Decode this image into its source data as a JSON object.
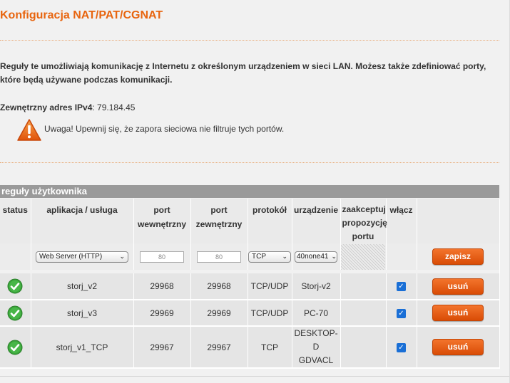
{
  "page": {
    "title": "Konfiguracja NAT/PAT/CGNAT",
    "intro": "Reguły te umożliwiają komunikację z Internetu z określonym urządzeniem w sieci LAN. Możesz także zdefiniować porty, które będą używane podczas komunikacji.",
    "ext_label": "Zewnętrzny adres IPv4",
    "ext_value": ": 79.184.45",
    "warning": "Uwaga! Upewnij się, że zapora sieciowa nie filtruje tych portów.",
    "warning_icon": "warning-triangle-icon"
  },
  "section": {
    "title": "reguły użytkownika"
  },
  "table": {
    "headers": {
      "status": "status",
      "app": "aplikacja / usługa",
      "port_int_1": "port",
      "port_int_2": "wewnętrzny",
      "port_ext_1": "port",
      "port_ext_2": "zewnętrzny",
      "protocol": "protokół",
      "device": "urządzenie",
      "accept_1": "zaakceptuj",
      "accept_2": "propozycję",
      "accept_3": "portu",
      "enable": "włącz"
    },
    "new_rule": {
      "app_select": "Web Server (HTTP)",
      "port_int_placeholder": "80",
      "port_ext_placeholder": "80",
      "protocol_select": "TCP",
      "device_select": "40none41",
      "save_label": "zapisz"
    },
    "rows": [
      {
        "status_icon": "check-ok-icon",
        "app": "storj_v2",
        "port_int": "29968",
        "port_ext": "29968",
        "protocol": "TCP/UDP",
        "device": "Storj-v2",
        "device_2": "",
        "enabled": true,
        "delete_label": "usuń"
      },
      {
        "status_icon": "check-ok-icon",
        "app": "storj_v3",
        "port_int": "29969",
        "port_ext": "29969",
        "protocol": "TCP/UDP",
        "device": "PC-70",
        "device_2": "",
        "enabled": true,
        "delete_label": "usuń"
      },
      {
        "status_icon": "check-ok-icon",
        "app": "storj_v1_TCP",
        "port_int": "29967",
        "port_ext": "29967",
        "protocol": "TCP",
        "device": "DESKTOP-D",
        "device_2": "GDVACL",
        "enabled": true,
        "delete_label": "usuń"
      }
    ]
  },
  "colors": {
    "accent": "#e8650f",
    "button": "#e05a10",
    "header_bar": "#9a9a9a",
    "check_green": "#3aa53a",
    "checkbox_blue": "#1a6fd6"
  }
}
